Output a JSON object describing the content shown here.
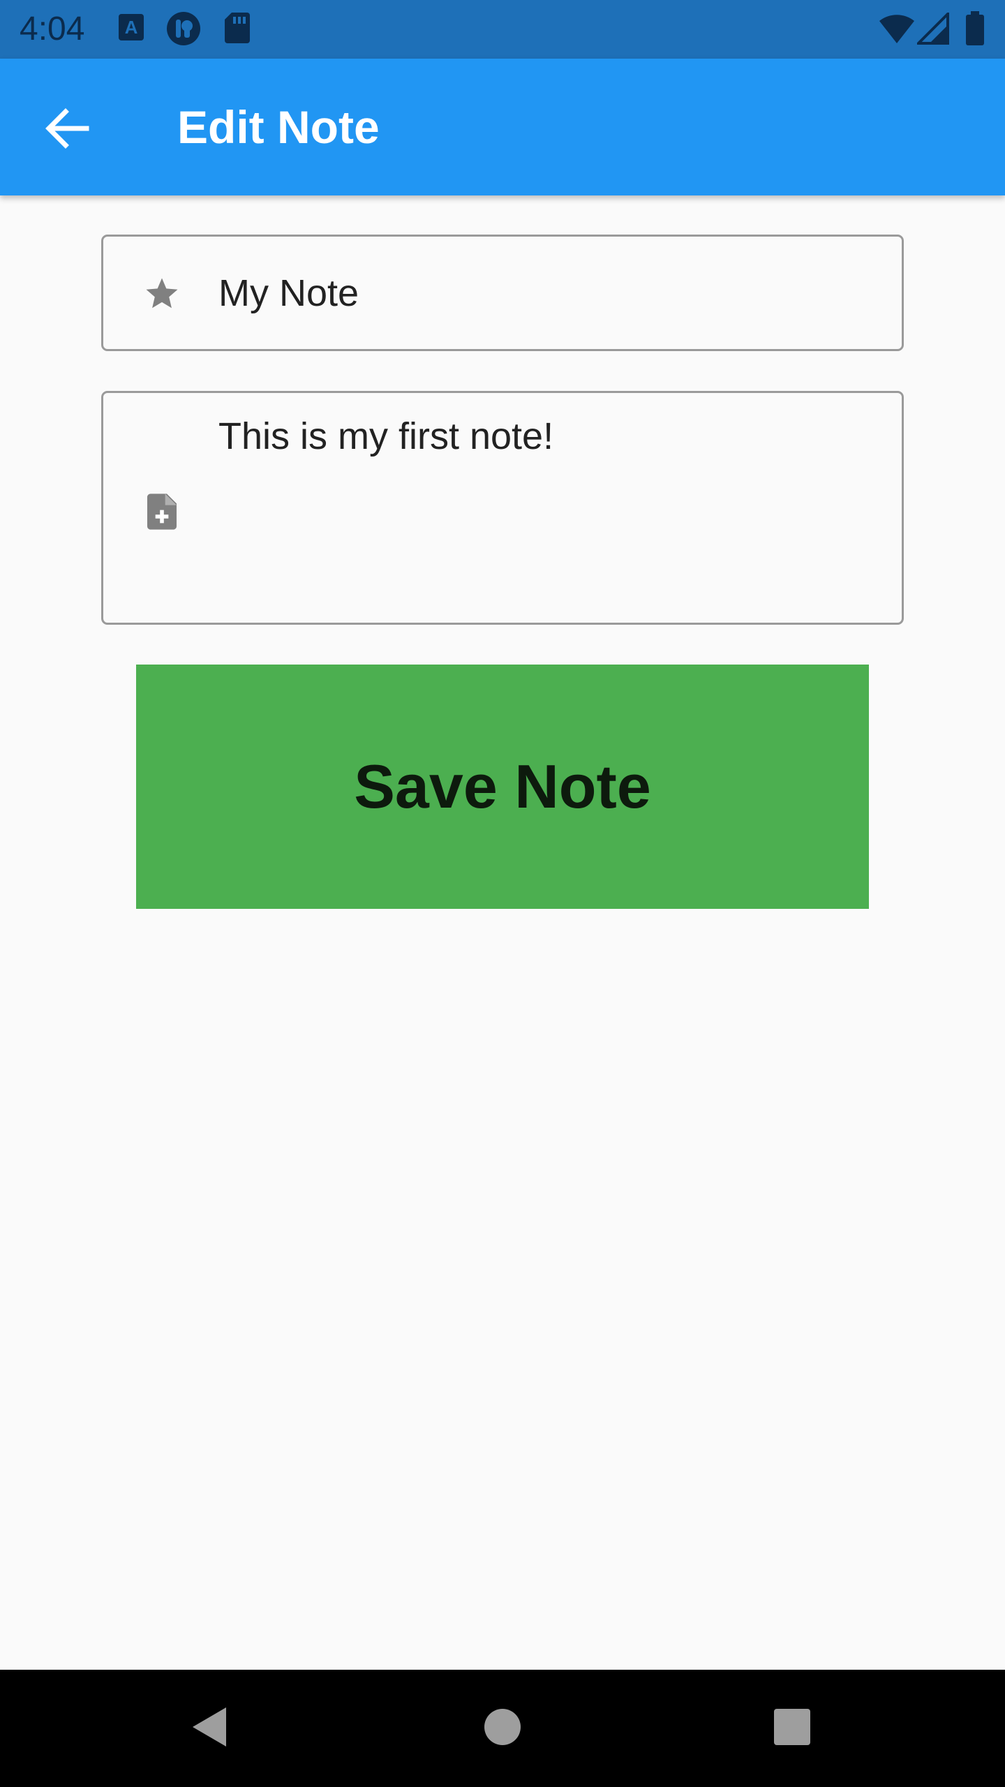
{
  "status_bar": {
    "time": "4:04",
    "icons": [
      "font-a-icon",
      "podcast-icon",
      "sd-card-icon",
      "wifi-icon",
      "cell-signal-icon",
      "battery-icon"
    ],
    "background": "#1e70b8"
  },
  "app_bar": {
    "title": "Edit Note",
    "back_icon": "arrow-back-icon",
    "background": "#2196f3"
  },
  "form": {
    "title_field": {
      "icon": "star-icon",
      "value": "My Note"
    },
    "body_field": {
      "icon": "note-add-icon",
      "value": "This is my first note!"
    },
    "save_button": {
      "label": "Save Note",
      "background": "#4caf50"
    }
  },
  "nav_bar": {
    "buttons": [
      "back-triangle-icon",
      "home-circle-icon",
      "recents-square-icon"
    ]
  }
}
